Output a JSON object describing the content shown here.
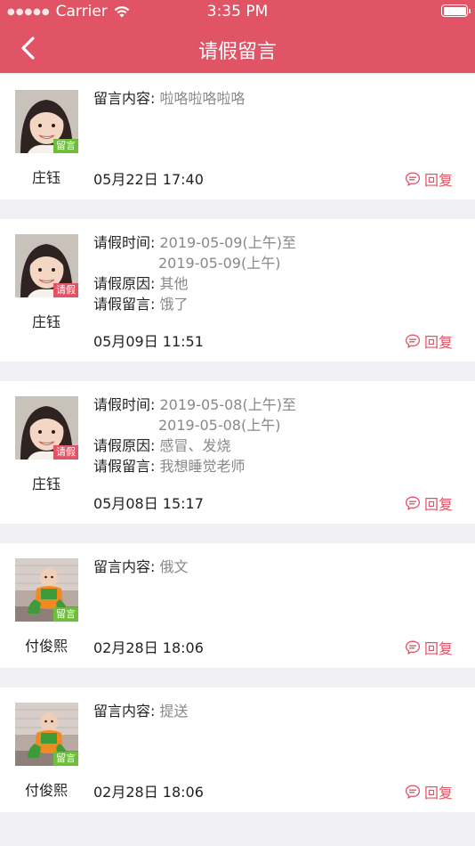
{
  "status_bar": {
    "carrier": "Carrier",
    "time": "3:35 PM"
  },
  "nav": {
    "title": "请假留言",
    "back_icon": "chevron-left-icon"
  },
  "colors": {
    "brand": "#e05465",
    "message_tag": "#6dbf3b",
    "leave_tag": "#e05465"
  },
  "labels": {
    "message": "留言内容:",
    "leave_time": "请假时间:",
    "leave_reason": "请假原因:",
    "leave_note": "请假留言:",
    "reply": "回复"
  },
  "items": [
    {
      "name": "庄钰",
      "tag": "留言",
      "content": "啦咯啦咯啦咯",
      "date": "05月22日 17:40"
    },
    {
      "name": "庄钰",
      "tag": "请假",
      "time_from": "2019-05-09(上午)至",
      "time_to": "2019-05-09(上午)",
      "reason": "其他",
      "note": "饿了",
      "date": "05月09日 11:51"
    },
    {
      "name": "庄钰",
      "tag": "请假",
      "time_from": "2019-05-08(上午)至",
      "time_to": "2019-05-08(上午)",
      "reason": "感冒、发烧",
      "note": "我想睡觉老师",
      "date": "05月08日 15:17"
    },
    {
      "name": "付俊熙",
      "tag": "留言",
      "content": "俄文",
      "date": "02月28日 18:06"
    },
    {
      "name": "付俊熙",
      "tag": "留言",
      "content": "提送",
      "date": "02月28日 18:06"
    }
  ]
}
